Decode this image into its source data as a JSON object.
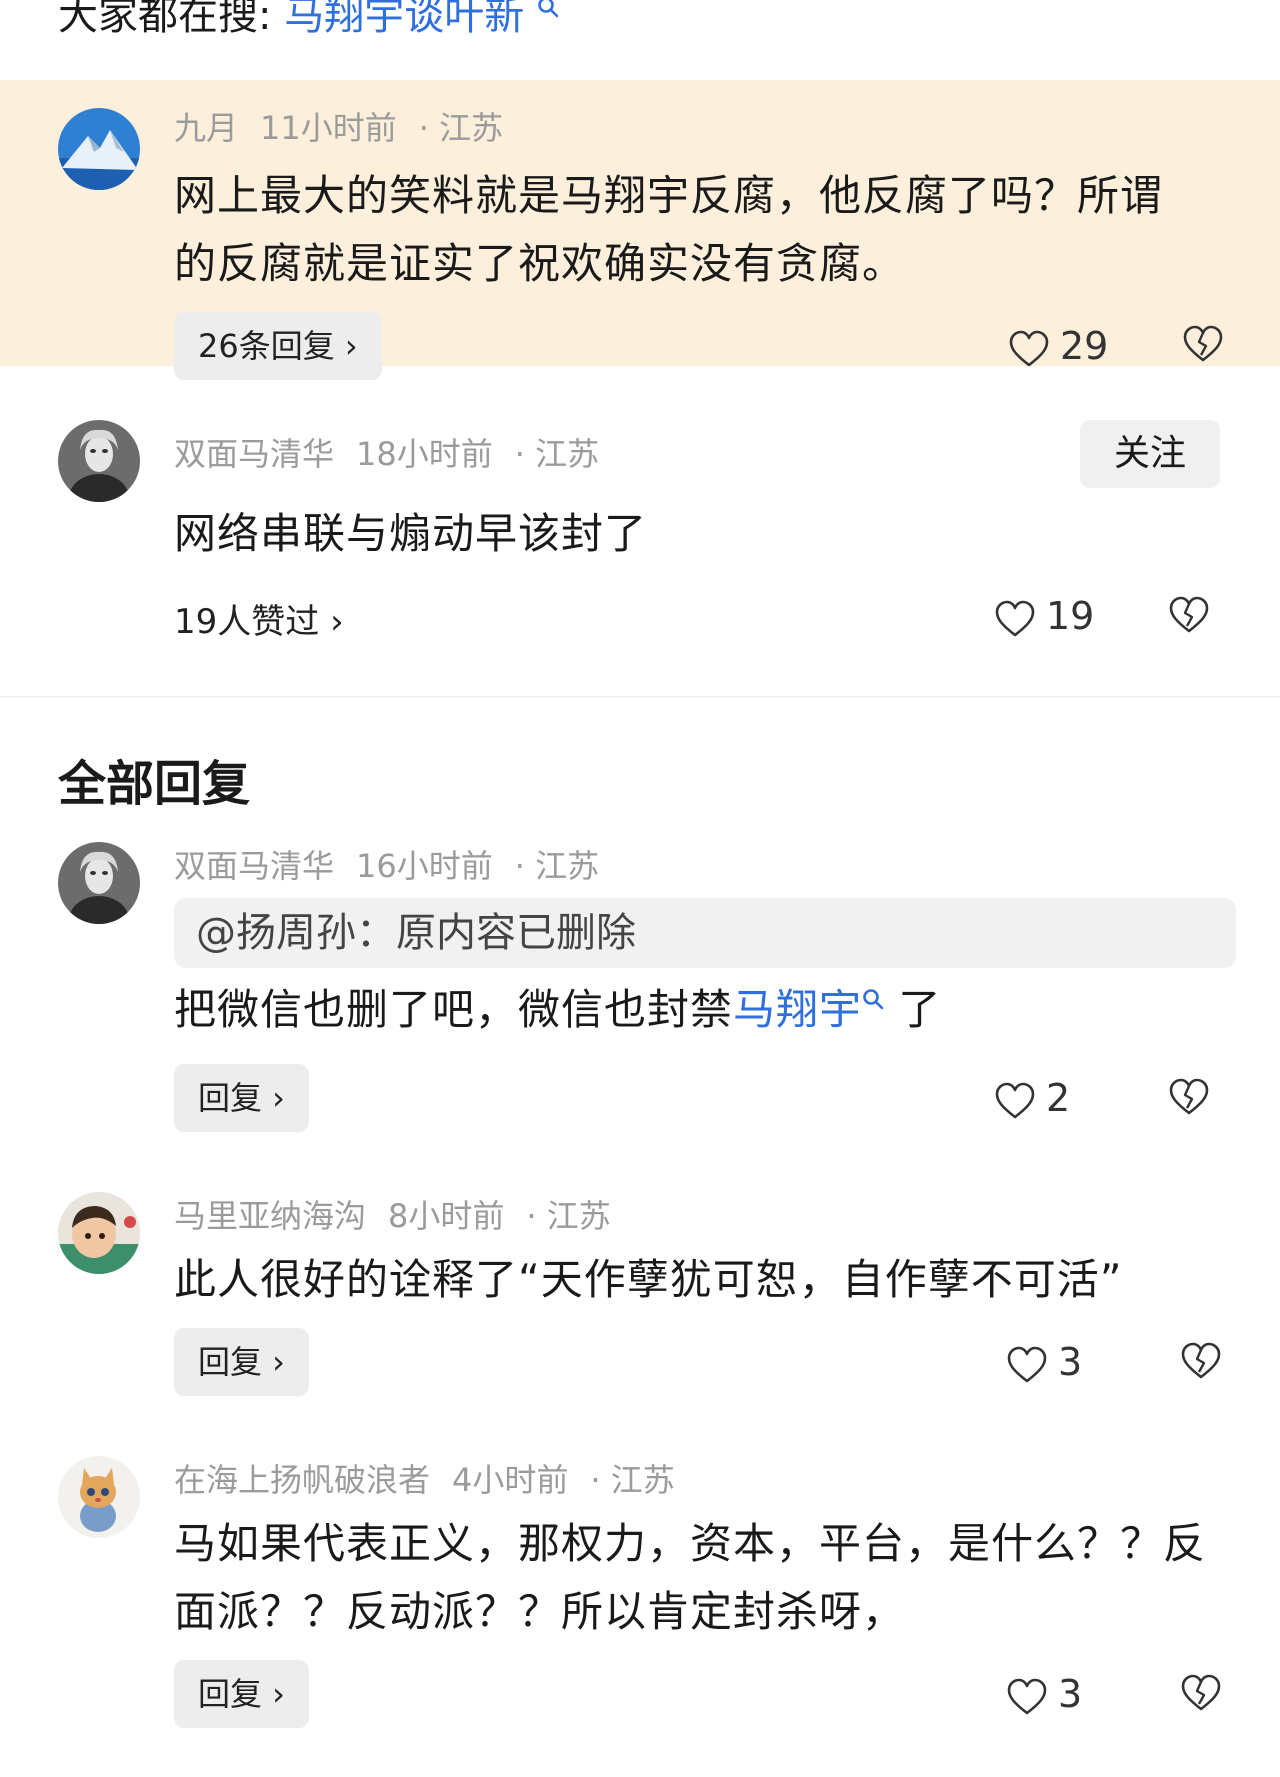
{
  "search": {
    "prefix": "大家都在搜: ",
    "keyword": "马翔宇谈叶新"
  },
  "comments": [
    {
      "author": "九月",
      "time": "11小时前",
      "location": "· 江苏",
      "text": "网上最大的笑料就是马翔宇反腐，他反腐了吗？所谓的反腐就是证实了祝欢确实没有贪腐。",
      "replies_label": "26条回复 ›",
      "likes": "29"
    },
    {
      "author": "双面马清华",
      "time": "18小时前",
      "location": "· 江苏",
      "follow_label": "关注",
      "text": "网络串联与煽动早该封了",
      "liked_by": "19人赞过 ›",
      "likes": "19"
    }
  ],
  "section_title": "全部回复",
  "replies": [
    {
      "author": "双面马清华",
      "time": "16小时前",
      "location": "· 江苏",
      "quote": "@扬周孙：原内容已删除",
      "text_before": "把微信也删了吧，微信也封禁",
      "mention": "马翔宇",
      "text_after": " 了",
      "reply_label": "回复 ›",
      "likes": "2"
    },
    {
      "author": "马里亚纳海沟",
      "time": "8小时前",
      "location": "· 江苏",
      "text": "此人很好的诠释了“天作孽犹可恕，自作孽不可活”",
      "reply_label": "回复 ›",
      "likes": "3"
    },
    {
      "author": "在海上扬帆破浪者",
      "time": "4小时前",
      "location": "· 江苏",
      "text": "马如果代表正义，那权力，资本，平台，是什么？？反面派？？反动派？？所以肯定封杀呀，",
      "reply_label": "回复 ›",
      "likes": "3"
    }
  ],
  "icons": {
    "search": "search-icon",
    "like": "heart-icon",
    "dislike": "broken-heart-icon"
  },
  "colors": {
    "accent": "#2f6fde",
    "highlight_bg": "#fcefdc",
    "meta": "#9b9b9b"
  }
}
